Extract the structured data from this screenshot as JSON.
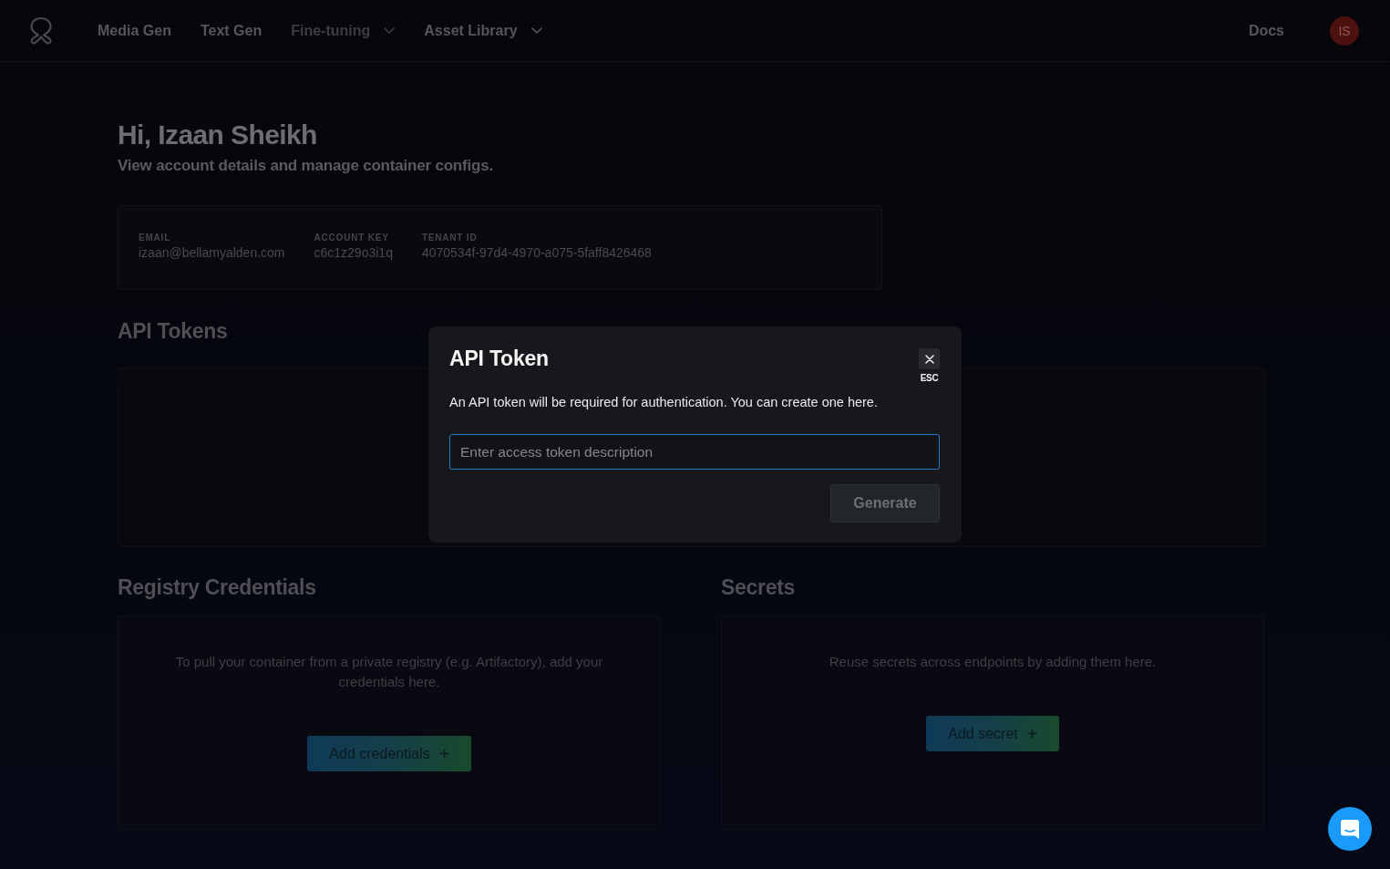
{
  "nav": {
    "items": [
      {
        "label": "Media Gen",
        "kind": "link",
        "disabled": false
      },
      {
        "label": "Text Gen",
        "kind": "link",
        "disabled": false
      },
      {
        "label": "Fine-tuning",
        "kind": "dropdown",
        "disabled": true
      },
      {
        "label": "Asset Library",
        "kind": "dropdown",
        "disabled": false
      }
    ],
    "docs": "Docs",
    "avatar": {
      "initials": "IS"
    }
  },
  "header": {
    "greeting": "Hi, Izaan Sheikh",
    "subtitle": "View account details and manage container configs."
  },
  "account": {
    "fields": [
      {
        "label": "EMAIL",
        "value": "izaan@bellamyalden.com"
      },
      {
        "label": "ACCOUNT KEY",
        "value": "c6c1z29o3i1q"
      },
      {
        "label": "TENANT ID",
        "value": "4070534f-97d4-4970-a075-5faff8426468"
      }
    ]
  },
  "api_tokens": {
    "title": "API Tokens"
  },
  "sections": [
    {
      "title": "Registry Credentials",
      "description": "To pull your container from a private registry (e.g. Artifactory), add your credentials here.",
      "button": "Add credentials"
    },
    {
      "title": "Secrets",
      "description": "Reuse secrets across endpoints by adding them here.",
      "button": "Add secret"
    }
  ],
  "modal": {
    "title": "API Token",
    "close_hint": "ESC",
    "description": "An API token will be required for authentication. You can create one here.",
    "input": {
      "placeholder": "Enter access token description"
    },
    "generate_button": {
      "label": "Generate",
      "disabled": true
    }
  }
}
